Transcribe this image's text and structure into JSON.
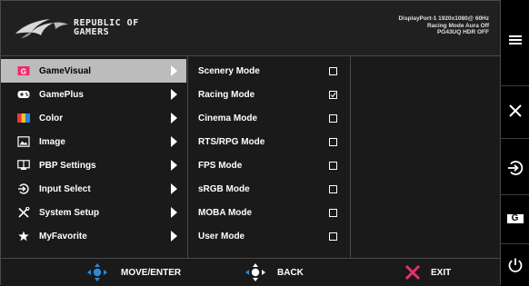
{
  "header": {
    "brand_line1": "REPUBLIC OF",
    "brand_line2": "GAMERS",
    "status_line1": "DisplayPort-1 1920x1080@ 60Hz",
    "status_line2": "Racing Mode Aura Off",
    "status_line3": "PG43UQ HDR OFF"
  },
  "menu": {
    "items": [
      {
        "label": "GameVisual",
        "icon": "gamevisual-icon",
        "active": true
      },
      {
        "label": "GamePlus",
        "icon": "gamepad-icon",
        "active": false
      },
      {
        "label": "Color",
        "icon": "color-palette-icon",
        "active": false
      },
      {
        "label": "Image",
        "icon": "image-icon",
        "active": false
      },
      {
        "label": "PBP Settings",
        "icon": "pbp-icon",
        "active": false
      },
      {
        "label": "Input Select",
        "icon": "input-select-icon",
        "active": false
      },
      {
        "label": "System Setup",
        "icon": "wrench-screwdriver-icon",
        "active": false
      },
      {
        "label": "MyFavorite",
        "icon": "star-icon",
        "active": false
      }
    ]
  },
  "modes": {
    "items": [
      {
        "label": "Scenery Mode",
        "checked": false
      },
      {
        "label": "Racing Mode",
        "checked": true
      },
      {
        "label": "Cinema Mode",
        "checked": false
      },
      {
        "label": "RTS/RPG Mode",
        "checked": false
      },
      {
        "label": "FPS Mode",
        "checked": false
      },
      {
        "label": "sRGB Mode",
        "checked": false
      },
      {
        "label": "MOBA Mode",
        "checked": false
      },
      {
        "label": "User Mode",
        "checked": false
      }
    ]
  },
  "footer": {
    "move_label": "MOVE/ENTER",
    "back_label": "BACK",
    "exit_label": "EXIT"
  },
  "side_buttons": {
    "gamevisual_letter": "G"
  },
  "colors": {
    "active_bg": "#bcbcbc",
    "nav_blue": "#2a8bd8",
    "exit_pink": "#e8306a"
  }
}
